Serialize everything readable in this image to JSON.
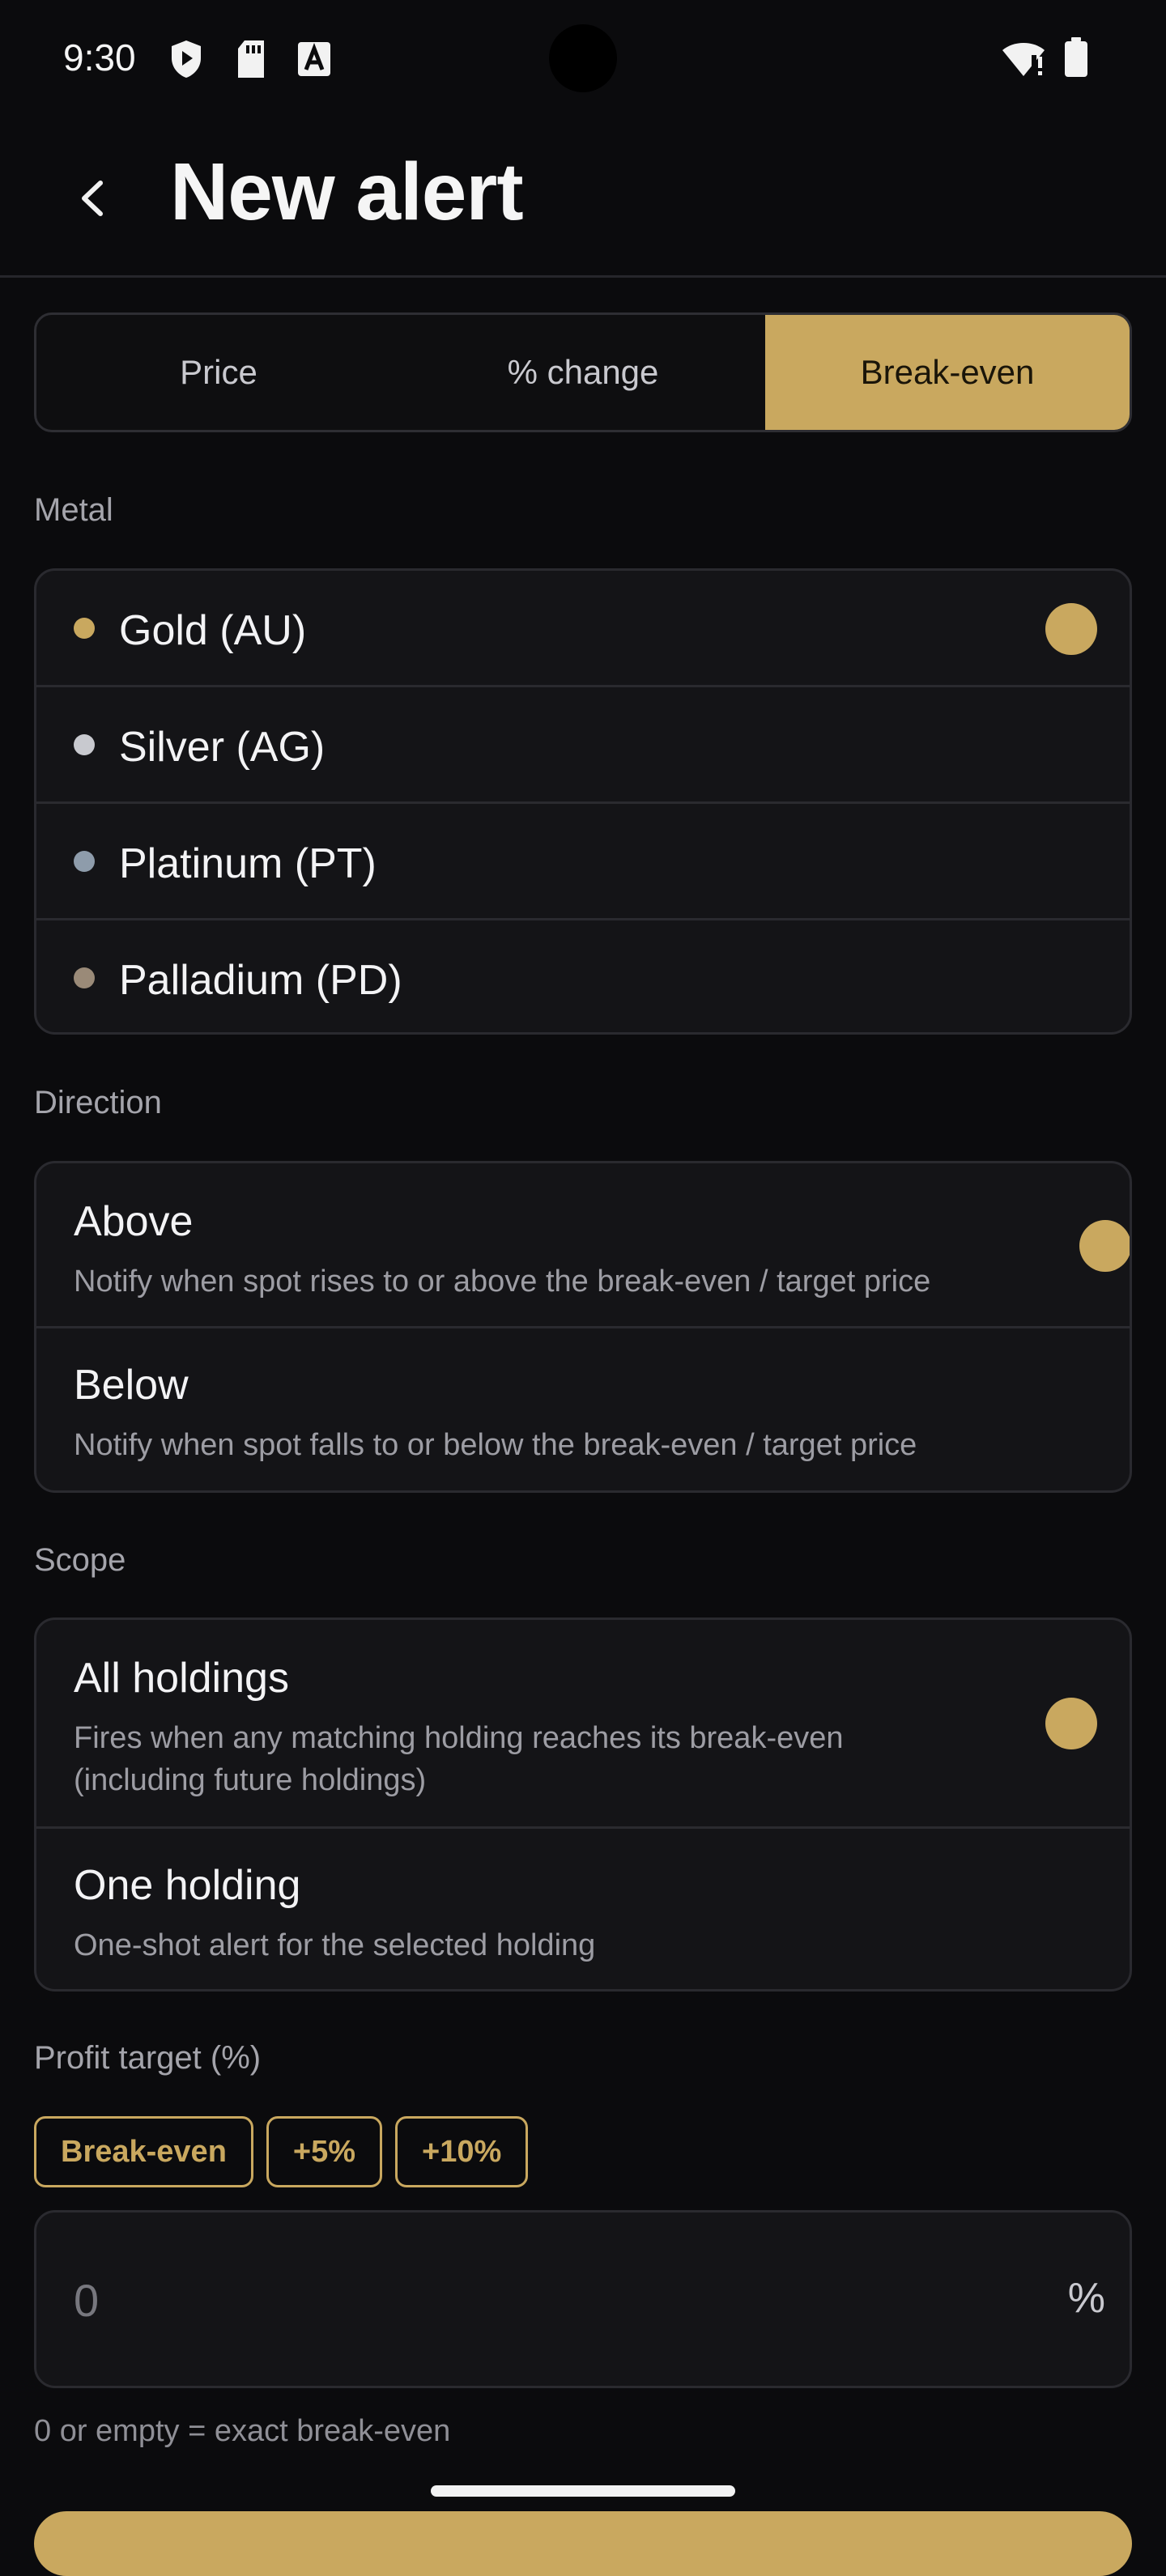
{
  "status_bar": {
    "time": "9:30",
    "left_icons": [
      "shield-play-icon",
      "sd-card-icon",
      "a-box-icon"
    ],
    "right_icons": [
      "wifi-alert-icon",
      "battery-icon"
    ]
  },
  "app_bar": {
    "title": "New alert",
    "back_icon": "chevron-left-icon"
  },
  "tabs": [
    {
      "label": "Price",
      "active": false
    },
    {
      "label": "% change",
      "active": false
    },
    {
      "label": "Break-even",
      "active": true
    }
  ],
  "metal": {
    "label": "Metal",
    "items": [
      {
        "label": "Gold (AU)",
        "color": "#c9a85f",
        "selected": true
      },
      {
        "label": "Silver (AG)",
        "color": "#c8c9cf",
        "selected": false
      },
      {
        "label": "Platinum (PT)",
        "color": "#8e9cab",
        "selected": false
      },
      {
        "label": "Palladium (PD)",
        "color": "#9a8a78",
        "selected": false
      }
    ]
  },
  "direction": {
    "label": "Direction",
    "items": [
      {
        "title": "Above",
        "desc": "Notify when spot rises to or above the break-even / target price",
        "selected": true
      },
      {
        "title": "Below",
        "desc": "Notify when spot falls to or below the break-even / target price",
        "selected": false
      }
    ]
  },
  "scope": {
    "label": "Scope",
    "items": [
      {
        "title": "All holdings",
        "desc_line1": "Fires when any matching holding reaches its break-even",
        "desc_line2": "(including future holdings)",
        "selected": true
      },
      {
        "title": "One holding",
        "desc_line1": "One-shot alert for the selected holding",
        "selected": false
      }
    ]
  },
  "profit_target": {
    "label": "Profit target (%)",
    "chips": [
      "Break-even",
      "+5%",
      "+10%"
    ],
    "value": "0",
    "suffix": "%",
    "helper": "0 or empty = exact break-even"
  },
  "colors": {
    "accent": "#c9a85f",
    "background": "#0b0b0d",
    "card": "#141417"
  }
}
